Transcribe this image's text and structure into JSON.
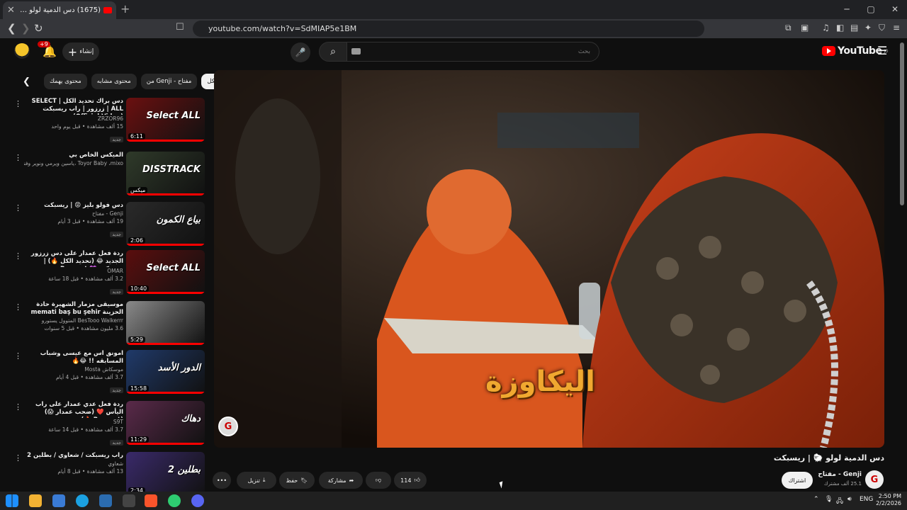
{
  "browser": {
    "tab_title": "(1675) دس الدمية لولو 🐑 | ريـ",
    "new_tab": "+",
    "url": "youtube.com/watch?v=SdMIAP5e1BM",
    "window_controls": [
      "─",
      "▢",
      "✕"
    ]
  },
  "header": {
    "logo_text": "YouTube",
    "logo_region": "JO",
    "search_placeholder": "بحث",
    "create_label": "إنشاء",
    "notifications_badge": "+9"
  },
  "chips": [
    "محتوى يهمك",
    "محتوى مشابه",
    "من Genji - مفتاح",
    "الكل"
  ],
  "recommendations": [
    {
      "title": "دس براك تحديد الكل | SELECT ALL | زرزور | راب ريسبكت (Official Video)",
      "channel": "ZRZOR96",
      "stats": "15 ألف مشاهدة • قبل يوم واحد",
      "badge": "جديد",
      "duration": "6:11",
      "thumb_text": "Select ALL",
      "thumb_color": "#6b1010"
    },
    {
      "title": "الميكس الخاص بي",
      "channel": "Toyor Baby ،mixo ،ياسين ويرمي ونوير وفنانون آخرون",
      "stats": "",
      "badge": "",
      "duration": "ميكس",
      "thumb_text": "DISSTRACK",
      "thumb_color": "#2f3a2a"
    },
    {
      "title": "دس فولو بليز 😡 | ريسبكت",
      "channel": "Genji - مفتاح",
      "stats": "19 ألف مشاهدة • قبل 3 أيام",
      "badge": "جديد",
      "duration": "2:06",
      "thumb_text": "بياع الكمون",
      "thumb_color": "#2a2a2a"
    },
    {
      "title": "ردة فعل عمدار على دس زرزور الجديد 😂 (تحديد الكل 🔥) | ريسبكت 💜 Respect",
      "channel": "OMAR",
      "stats": "3.2 ألف مشاهدة • قبل 18 ساعة",
      "badge": "جديد",
      "duration": "10:40",
      "thumb_text": "Select ALL",
      "thumb_color": "#5a0e0e"
    },
    {
      "title": "موسيقى مزمار الشهيرة حادة الحزينة memati baş bu şehir",
      "channel": "BesTooo Walkerrr المتوول يستورو",
      "stats": "3.6 مليون مشاهدة • قبل 5 سنوات",
      "badge": "",
      "duration": "5:29",
      "thumb_text": "",
      "thumb_color": "#8a8a8a"
    },
    {
      "title": "امونق اس مع عيسى وشباب المسابقه !! 😂🔥",
      "channel": "موسكاش Mosta",
      "stats": "3.7 ألف مشاهدة • قبل 4 أيام",
      "badge": "جديد",
      "duration": "15:58",
      "thumb_text": "الدور الأسد",
      "thumb_color": "#203a6a"
    },
    {
      "title": "ردة فعل عدي عمدار على راب اليأس ❤️ (ضحب عمدار 😱)(Respect 🔥)...",
      "channel": "S9T",
      "stats": "3.7 ألف مشاهدة • قبل 14 ساعة",
      "badge": "جديد",
      "duration": "11:29",
      "thumb_text": "دهاك",
      "thumb_color": "#5a2a4a"
    },
    {
      "title": "راب ريسبكت / شعاوي / بطلين 2",
      "channel": "شعاوي",
      "stats": "13 ألف مشاهدة • قبل 8 أيام",
      "badge": "",
      "duration": "2:34",
      "thumb_text": "بطلين 2",
      "thumb_color": "#3a2a6a"
    }
  ],
  "player": {
    "caption": "اليكاوزة",
    "channel_watermark": "G"
  },
  "video": {
    "title": "دس الدمية لولو 🐑 | ريسبكت",
    "channel_name": "Genji - مفتاح",
    "subscribers": "25.1 ألف مشترك",
    "subscribe_label": "اشتراك",
    "likes": "114",
    "share_label": "مشاركة",
    "save_label": "حفظ",
    "download_label": "تنزيل",
    "more": "•••"
  },
  "taskbar": {
    "lang": "ENG",
    "time": "2:50 PM",
    "date": "2/2/2026"
  }
}
